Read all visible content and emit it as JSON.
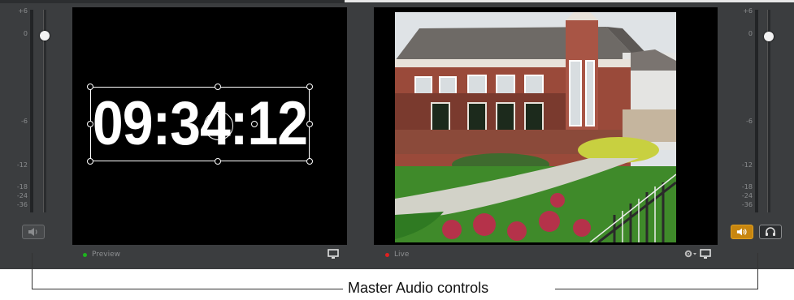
{
  "meter_scale": [
    "+6",
    "0",
    "-6",
    "-12",
    "-18",
    "-24",
    "-36"
  ],
  "preview": {
    "clock": "09:34:12",
    "status": "Preview",
    "status_color": "#1db31d"
  },
  "live": {
    "status": "Live",
    "status_color": "#e02020"
  },
  "colors": {
    "panel_bg": "#3b3d3f",
    "monitor_bg": "#000000",
    "speaker_active": "#c8860f"
  },
  "icons": {
    "mute": "speaker-muted-icon",
    "speaker": "speaker-icon",
    "headphones": "headphones-icon",
    "monitor": "monitor-icon",
    "settings": "gear-icon"
  },
  "callout": {
    "label": "Master Audio controls"
  }
}
